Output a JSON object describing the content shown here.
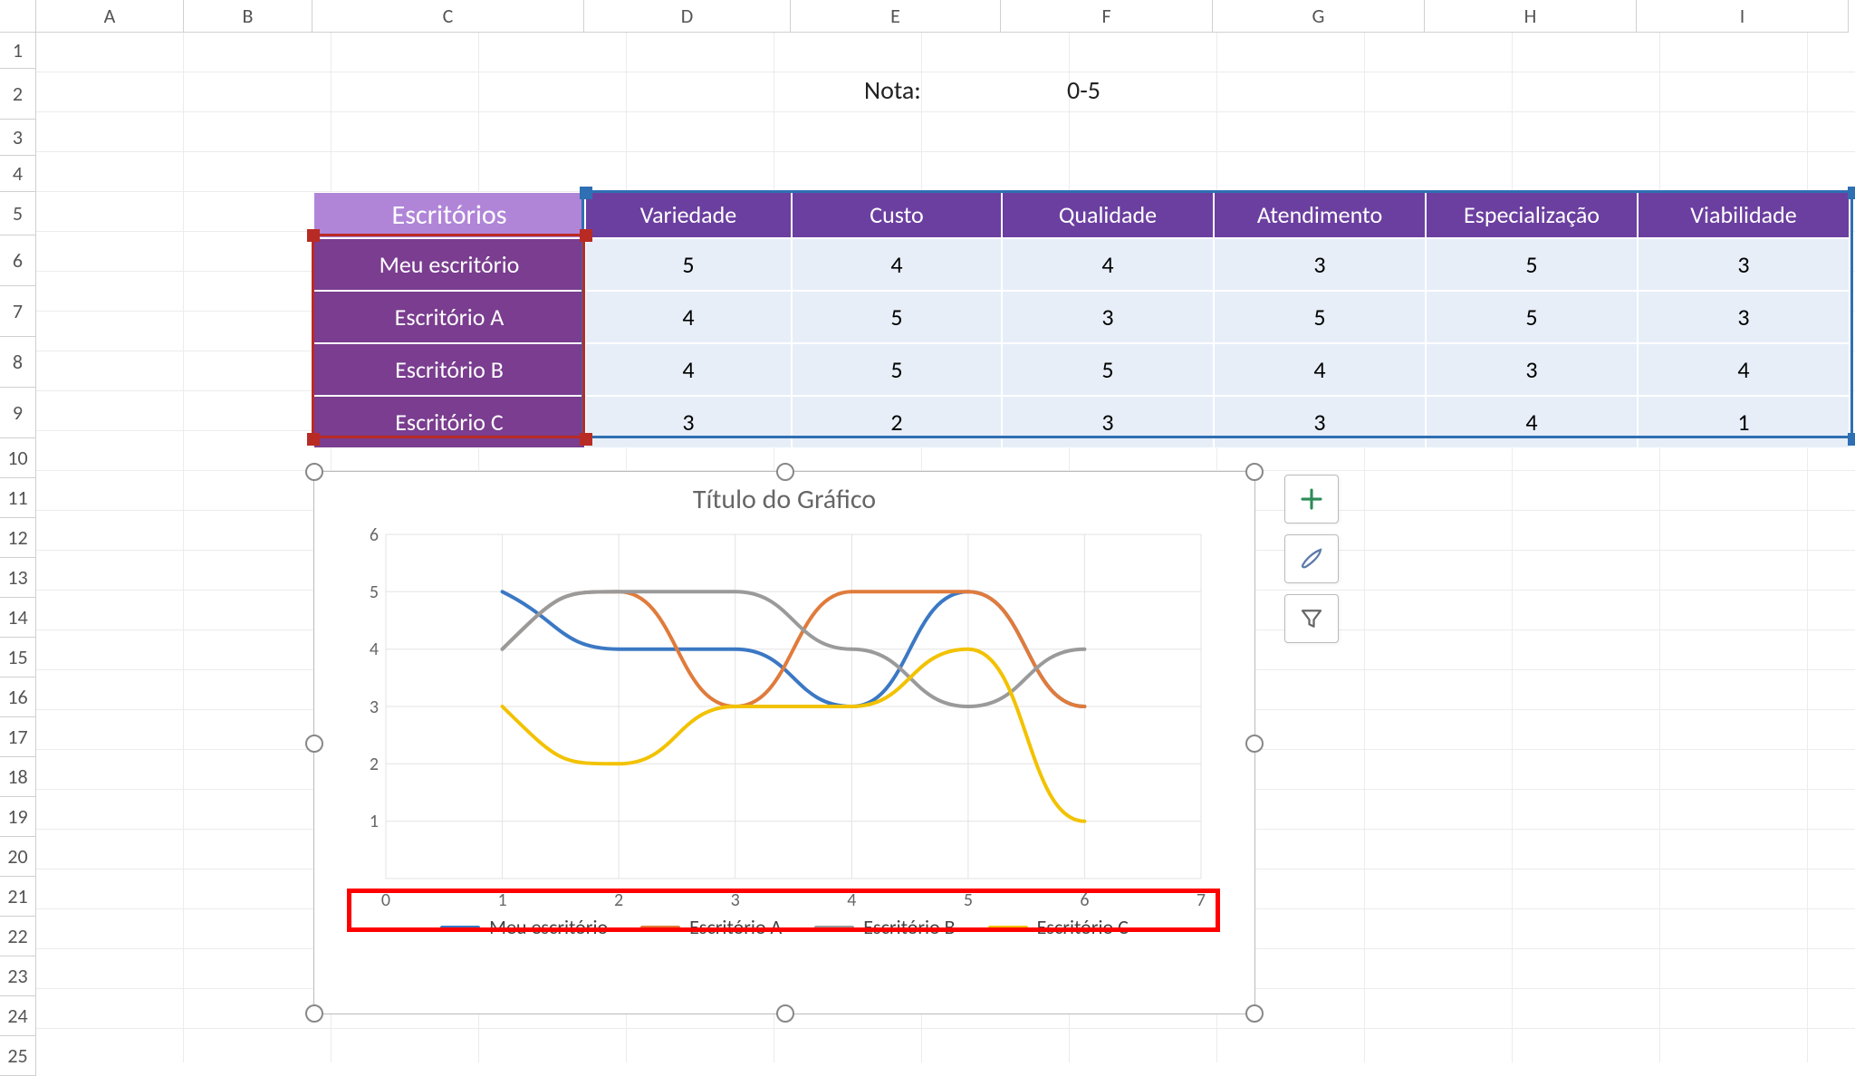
{
  "row_labels": [
    "1",
    "2",
    "3",
    "4",
    "5",
    "6",
    "7",
    "8",
    "9",
    "10",
    "11",
    "12",
    "13",
    "14",
    "15",
    "16",
    "17",
    "18",
    "19",
    "20",
    "21",
    "22",
    "23",
    "24",
    "25"
  ],
  "col_labels": {
    "A": "A",
    "B": "B",
    "C": "C",
    "D": "D",
    "E": "E",
    "F": "F",
    "G": "G",
    "H": "H",
    "I": "I"
  },
  "note": {
    "label": "Nota:",
    "range": "0-5"
  },
  "table": {
    "corner": "Escritórios",
    "cols": [
      "Variedade",
      "Custo",
      "Qualidade",
      "Atendimento",
      "Especialização",
      "Viabilidade"
    ],
    "rows": [
      {
        "name": "Meu escritório",
        "v": [
          5,
          4,
          4,
          3,
          5,
          3
        ]
      },
      {
        "name": "Escritório A",
        "v": [
          4,
          5,
          3,
          5,
          5,
          3
        ]
      },
      {
        "name": "Escritório B",
        "v": [
          4,
          5,
          5,
          4,
          3,
          4
        ]
      },
      {
        "name": "Escritório C",
        "v": [
          3,
          2,
          3,
          3,
          4,
          1
        ]
      }
    ]
  },
  "chart": {
    "title": "Título do Gráfico",
    "xticks": [
      0,
      1,
      2,
      3,
      4,
      5,
      6,
      7
    ],
    "yticks": [
      1,
      2,
      3,
      4,
      5,
      6
    ],
    "legend": [
      "Meu escritório",
      "Escritório A",
      "Escritório B",
      "Escritório C"
    ]
  },
  "chart_data": {
    "type": "line",
    "title": "Título do Gráfico",
    "xlabel": "",
    "ylabel": "",
    "xlim": [
      0,
      7
    ],
    "ylim": [
      0,
      6
    ],
    "x": [
      1,
      2,
      3,
      4,
      5,
      6
    ],
    "series": [
      {
        "name": "Meu escritório",
        "color": "#3b78c4",
        "values": [
          5,
          4,
          4,
          3,
          5,
          3
        ]
      },
      {
        "name": "Escritório A",
        "color": "#e07b3c",
        "values": [
          4,
          5,
          3,
          5,
          5,
          3
        ]
      },
      {
        "name": "Escritório B",
        "color": "#9a9a9a",
        "values": [
          4,
          5,
          5,
          4,
          3,
          4
        ]
      },
      {
        "name": "Escritório C",
        "color": "#f2c200",
        "values": [
          3,
          2,
          3,
          3,
          4,
          1
        ]
      }
    ],
    "legend_position": "bottom",
    "grid": true
  },
  "chart_buttons": {
    "add": "add",
    "style": "style",
    "filter": "filter"
  }
}
